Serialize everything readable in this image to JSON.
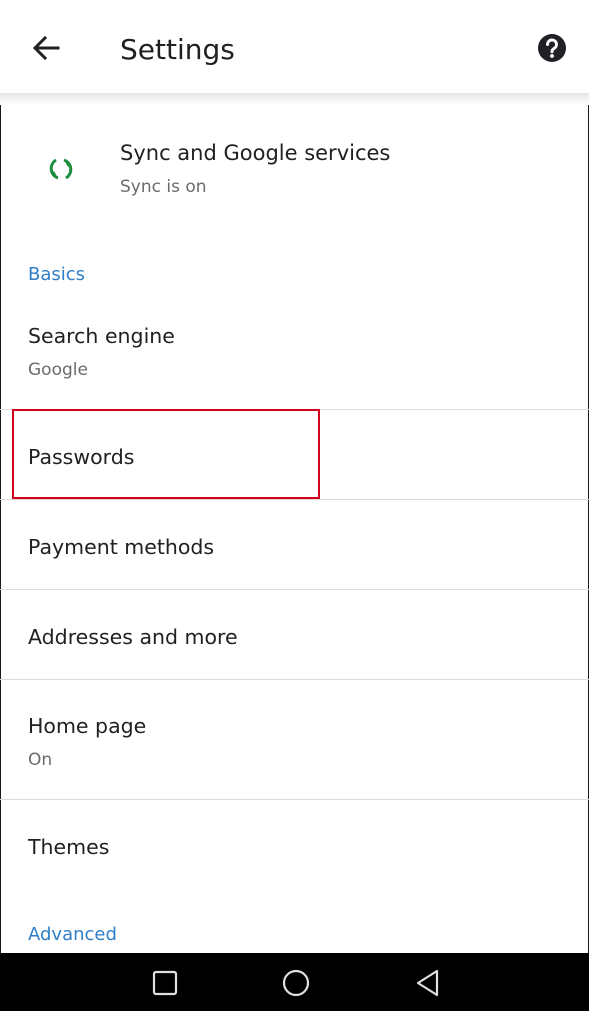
{
  "header": {
    "title": "Settings",
    "back_icon": "arrow-back-icon",
    "help_icon": "help-circle-icon"
  },
  "sync": {
    "title": "Sync and Google services",
    "subtitle": "Sync is on",
    "icon": "sync-icon",
    "icon_color": "#1e8e3e"
  },
  "sections": {
    "basics": "Basics",
    "advanced": "Advanced"
  },
  "items": {
    "search_engine": {
      "title": "Search engine",
      "subtitle": "Google"
    },
    "passwords": {
      "title": "Passwords"
    },
    "payment_methods": {
      "title": "Payment methods"
    },
    "addresses": {
      "title": "Addresses and more"
    },
    "home_page": {
      "title": "Home page",
      "subtitle": "On"
    },
    "themes": {
      "title": "Themes"
    }
  },
  "nav": {
    "recents_icon": "square-recents-icon",
    "home_icon": "circle-home-icon",
    "back_icon": "triangle-back-icon"
  },
  "colors": {
    "accent": "#2f7ec7",
    "highlight": "#d0021b"
  }
}
